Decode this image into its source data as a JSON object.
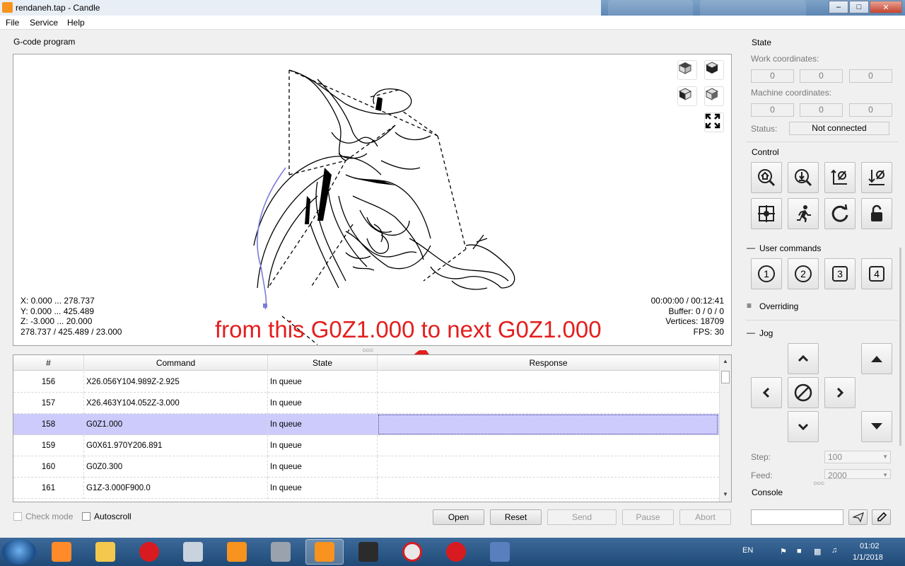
{
  "window": {
    "title": "rendaneh.tap - Candle",
    "controls": [
      "minimize-icon",
      "maximize-icon",
      "close-icon"
    ]
  },
  "menu": [
    "File",
    "Service",
    "Help"
  ],
  "gcode_group_title": "G-code program",
  "viewer": {
    "view_buttons": [
      "cube-top-icon",
      "cube-front-icon",
      "cube-left-icon",
      "cube-iso-icon",
      "fit-view-icon"
    ],
    "info_left": [
      "X: 0.000 ... 278.737",
      "Y: 0.000 ... 425.489",
      "Z: -3.000 ... 20.000",
      "278.737 / 425.489 / 23.000"
    ],
    "info_right": [
      "00:00:00 / 00:12:41",
      "Buffer: 0 / 0 / 0",
      "Vertices: 18709",
      "FPS: 30"
    ],
    "annotation_text": "from this G0Z1.000 to next G0Z1.000",
    "annotation_color": "#e31e1e"
  },
  "table": {
    "headers": [
      "#",
      "Command",
      "State",
      "Response"
    ],
    "rows": [
      {
        "num": "156",
        "command": "X26.056Y104.989Z-2.925",
        "state": "In queue",
        "response": ""
      },
      {
        "num": "157",
        "command": "X26.463Y104.052Z-3.000",
        "state": "In queue",
        "response": ""
      },
      {
        "num": "158",
        "command": "G0Z1.000",
        "state": "In queue",
        "response": "",
        "selected": true
      },
      {
        "num": "159",
        "command": "G0X61.970Y206.891",
        "state": "In queue",
        "response": ""
      },
      {
        "num": "160",
        "command": "G0Z0.300",
        "state": "In queue",
        "response": ""
      },
      {
        "num": "161",
        "command": "G1Z-3.000F900.0",
        "state": "In queue",
        "response": ""
      }
    ],
    "selection_color": "#cccbfc"
  },
  "bottom": {
    "check_mode": "Check mode",
    "autoscroll": "Autoscroll",
    "buttons": {
      "open": "Open",
      "reset": "Reset",
      "send": "Send",
      "pause": "Pause",
      "abort": "Abort"
    }
  },
  "state": {
    "title": "State",
    "work_label": "Work coordinates:",
    "work": [
      "0",
      "0",
      "0"
    ],
    "machine_label": "Machine coordinates:",
    "machine": [
      "0",
      "0",
      "0"
    ],
    "status_label": "Status:",
    "status_value": "Not connected"
  },
  "control": {
    "title": "Control",
    "buttons": [
      "home-icon",
      "probe-icon",
      "zero-xy-icon",
      "zero-z-icon",
      "restore-origin-icon",
      "safe-position-icon",
      "reset-icon",
      "unlock-icon"
    ]
  },
  "user_commands": {
    "title": "User commands",
    "buttons": [
      "1",
      "2",
      "3",
      "4"
    ]
  },
  "overriding": {
    "title": "Overriding"
  },
  "jog": {
    "title": "Jog",
    "step_label": "Step:",
    "step_value": "100",
    "feed_label": "Feed:",
    "feed_value": "2000"
  },
  "console": {
    "title": "Console"
  },
  "taskbar": {
    "language": "EN",
    "time": "01:02",
    "date": "1/1/2018"
  }
}
